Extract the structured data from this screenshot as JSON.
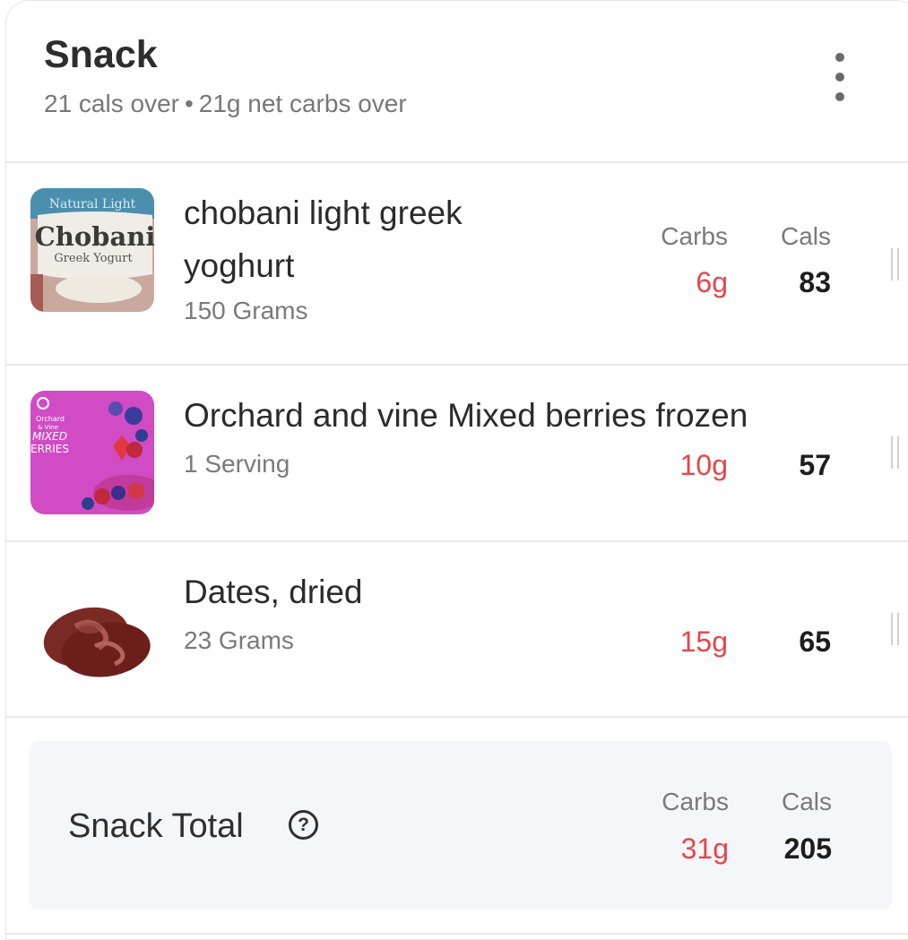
{
  "meal": {
    "title": "Snack",
    "cals_over": "21 cals over",
    "separator": "•",
    "carbs_over": "21g net carbs over"
  },
  "columns": {
    "carbs": "Carbs",
    "cals": "Cals"
  },
  "items": [
    {
      "name_line1": "chobani light greek",
      "name_line2": "yoghurt",
      "quantity": "150 Grams",
      "carbs": "6g",
      "cals": "83",
      "image": "chobani-yogurt-cup"
    },
    {
      "name_line1": "Orchard and vine Mixed berries frozen",
      "quantity": "1 Serving",
      "carbs": "10g",
      "cals": "57",
      "image": "mixed-berries-bag"
    },
    {
      "name_line1": "Dates, dried",
      "quantity": "23 Grams",
      "carbs": "15g",
      "cals": "65",
      "image": "dried-dates"
    }
  ],
  "total": {
    "label": "Snack Total",
    "help_glyph": "?",
    "carbs": "31g",
    "cals": "205"
  },
  "colors": {
    "over": "#e8454a",
    "total_bg": "#f5f6f9",
    "muted": "#7a7a7a"
  },
  "icons": {
    "menu": "kebab-menu-icon",
    "help": "question-circle-icon",
    "drag": "drag-handle-icon"
  }
}
